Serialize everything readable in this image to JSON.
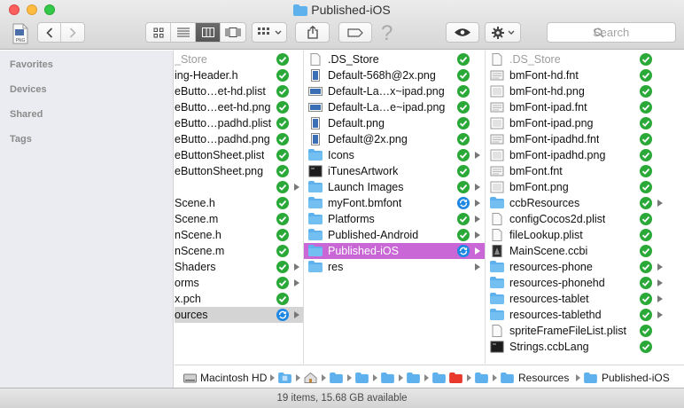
{
  "window": {
    "title": "Published-iOS"
  },
  "toolbar": {
    "proxy_icon_label": "PNG",
    "search_placeholder": "Search"
  },
  "sidebar": {
    "sections": [
      "Favorites",
      "Devices",
      "Shared",
      "Tags"
    ]
  },
  "column1": [
    {
      "name": "_Store",
      "dim": true,
      "badge": "ok"
    },
    {
      "name": "ing-Header.h",
      "badge": "ok"
    },
    {
      "name": "eButto…et-hd.plist",
      "badge": "ok"
    },
    {
      "name": "eButto…eet-hd.png",
      "badge": "ok"
    },
    {
      "name": "eButto…padhd.plist",
      "badge": "ok"
    },
    {
      "name": "eButto…padhd.png",
      "badge": "ok"
    },
    {
      "name": "eButtonSheet.plist",
      "badge": "ok"
    },
    {
      "name": "eButtonSheet.png",
      "badge": "ok"
    },
    {
      "name": "",
      "badge": "ok",
      "arrow": true
    },
    {
      "name": "Scene.h",
      "badge": "ok"
    },
    {
      "name": "Scene.m",
      "badge": "ok"
    },
    {
      "name": "nScene.h",
      "badge": "ok"
    },
    {
      "name": "nScene.m",
      "badge": "ok"
    },
    {
      "name": "Shaders",
      "badge": "ok",
      "arrow": true
    },
    {
      "name": "orms",
      "badge": "ok",
      "arrow": true
    },
    {
      "name": "x.pch",
      "badge": "ok"
    },
    {
      "name": "ources",
      "badge": "sync",
      "arrow": true,
      "selected": "gray"
    }
  ],
  "column2": [
    {
      "name": ".DS_Store",
      "icon": "doc",
      "badge": "ok"
    },
    {
      "name": "Default-568h@2x.png",
      "icon": "img-portrait",
      "badge": "ok"
    },
    {
      "name": "Default-La…x~ipad.png",
      "icon": "img-landscape",
      "badge": "ok"
    },
    {
      "name": "Default-La…e~ipad.png",
      "icon": "img-landscape",
      "badge": "ok"
    },
    {
      "name": "Default.png",
      "icon": "img-portrait",
      "badge": "ok"
    },
    {
      "name": "Default@2x.png",
      "icon": "img-portrait",
      "badge": "ok"
    },
    {
      "name": "Icons",
      "icon": "folder",
      "badge": "ok",
      "arrow": true
    },
    {
      "name": "iTunesArtwork",
      "icon": "black",
      "badge": "ok"
    },
    {
      "name": "Launch Images",
      "icon": "folder",
      "badge": "ok",
      "arrow": true
    },
    {
      "name": "myFont.bmfont",
      "icon": "folder",
      "badge": "sync",
      "arrow": true
    },
    {
      "name": "Platforms",
      "icon": "folder",
      "badge": "ok",
      "arrow": true
    },
    {
      "name": "Published-Android",
      "icon": "folder",
      "badge": "ok",
      "arrow": true
    },
    {
      "name": "Published-iOS",
      "icon": "folder",
      "badge": "sync",
      "arrow": true,
      "selected": "pink"
    },
    {
      "name": "res",
      "icon": "folder",
      "arrow": true
    }
  ],
  "column3": [
    {
      "name": ".DS_Store",
      "icon": "doc",
      "badge": "ok",
      "dim": true
    },
    {
      "name": "bmFont-hd.fnt",
      "icon": "fnt",
      "badge": "ok"
    },
    {
      "name": "bmFont-hd.png",
      "icon": "png",
      "badge": "ok"
    },
    {
      "name": "bmFont-ipad.fnt",
      "icon": "fnt",
      "badge": "ok"
    },
    {
      "name": "bmFont-ipad.png",
      "icon": "png",
      "badge": "ok"
    },
    {
      "name": "bmFont-ipadhd.fnt",
      "icon": "fnt",
      "badge": "ok"
    },
    {
      "name": "bmFont-ipadhd.png",
      "icon": "png",
      "badge": "ok"
    },
    {
      "name": "bmFont.fnt",
      "icon": "fnt",
      "badge": "ok"
    },
    {
      "name": "bmFont.png",
      "icon": "png",
      "badge": "ok"
    },
    {
      "name": "ccbResources",
      "icon": "folder",
      "badge": "ok",
      "arrow": true
    },
    {
      "name": "configCocos2d.plist",
      "icon": "doc",
      "badge": "ok"
    },
    {
      "name": "fileLookup.plist",
      "icon": "doc",
      "badge": "ok"
    },
    {
      "name": "MainScene.ccbi",
      "icon": "ccbi",
      "badge": "ok"
    },
    {
      "name": "resources-phone",
      "icon": "folder",
      "badge": "ok",
      "arrow": true
    },
    {
      "name": "resources-phonehd",
      "icon": "folder",
      "badge": "ok",
      "arrow": true
    },
    {
      "name": "resources-tablet",
      "icon": "folder",
      "badge": "ok",
      "arrow": true
    },
    {
      "name": "resources-tablethd",
      "icon": "folder",
      "badge": "ok",
      "arrow": true
    },
    {
      "name": "spriteFrameFileList.plist",
      "icon": "doc",
      "badge": "ok"
    },
    {
      "name": "Strings.ccbLang",
      "icon": "black",
      "badge": "ok"
    }
  ],
  "pathbar": {
    "items": [
      "Macintosh HD",
      "Resources",
      "Published-iOS"
    ]
  },
  "status": {
    "text": "19 items, 15.68 GB available"
  },
  "colors": {
    "selection": "#c967d6",
    "ok_badge": "#2aa938",
    "sync_badge": "#1e87e4",
    "folder": "#5fb1ee"
  }
}
